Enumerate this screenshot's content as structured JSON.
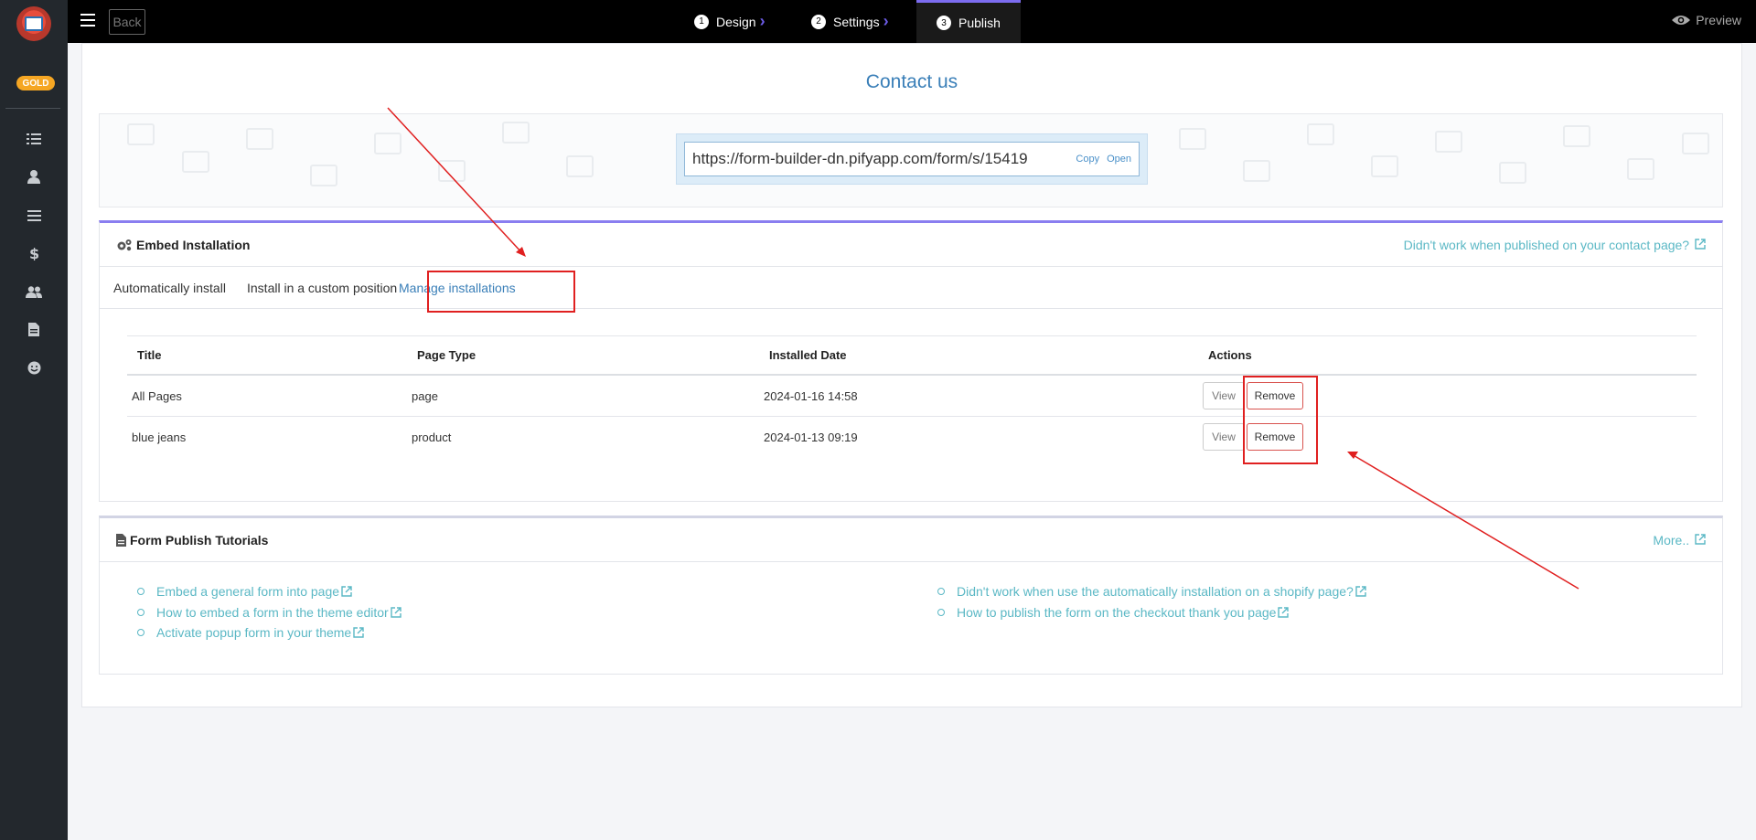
{
  "sidebar": {
    "badge": "GOLD",
    "icons": [
      "list-icon",
      "user-icon",
      "menu-icon",
      "dollar-icon",
      "users-icon",
      "document-icon",
      "smile-icon"
    ]
  },
  "topbar": {
    "back_label": "Back",
    "steps": [
      {
        "num": "1",
        "label": "Design"
      },
      {
        "num": "2",
        "label": "Settings"
      },
      {
        "num": "3",
        "label": "Publish"
      }
    ],
    "preview_label": "Preview"
  },
  "main": {
    "title": "Contact us",
    "url": "https://form-builder-dn.pifyapp.com/form/s/15419",
    "copy_label": "Copy",
    "open_label": "Open"
  },
  "embed": {
    "title": "Embed Installation",
    "help_link": "Didn't work when published on your contact page?",
    "tabs": [
      "Automatically install",
      "Install in a custom position",
      "Manage installations"
    ],
    "columns": [
      "Title",
      "Page Type",
      "Installed Date",
      "Actions"
    ],
    "rows": [
      {
        "title": "All Pages",
        "page_type": "page",
        "date": "2024-01-16 14:58"
      },
      {
        "title": "blue jeans",
        "page_type": "product",
        "date": "2024-01-13 09:19"
      }
    ],
    "view_label": "View",
    "remove_label": "Remove"
  },
  "tutorials": {
    "title": "Form Publish Tutorials",
    "more_label": "More..",
    "left": [
      "Embed a general form into page",
      "How to embed a form in the theme editor",
      "Activate popup form in your theme"
    ],
    "right": [
      "Didn't work when use the automatically installation on a shopify page?",
      "How to publish the form on the checkout thank you page"
    ]
  },
  "colors": {
    "accent": "#3a7fb8",
    "link": "#5bb8c5",
    "annotation": "#e02020",
    "purple": "#8a7ef0"
  }
}
